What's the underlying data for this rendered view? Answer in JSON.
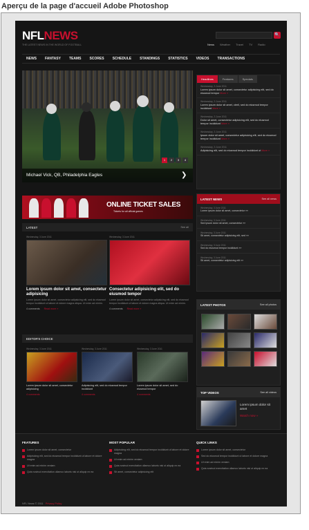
{
  "caption": "Aperçu de la page d'accueil Adobe Photoshop",
  "header": {
    "logo_a": "NFL",
    "logo_b": "NEWS",
    "tagline": "THE LATEST NEWS IN THE WORLD OF FOOTBALL",
    "search_button": "🔍",
    "top_links": [
      "News",
      "Weather",
      "Travel",
      "TV",
      "Radio"
    ]
  },
  "nav": [
    "NEWS",
    "FANTASY",
    "TEAMS",
    "SCORES",
    "SCHEDULE",
    "STANDINGS",
    "STATISTICS",
    "VIDEOS",
    "TRANSACTIONS"
  ],
  "hero": {
    "caption": "Michael Vick, QB, Philadelphia Eagles",
    "pages": [
      "1",
      "2",
      "3",
      "4"
    ],
    "arrow": "❯"
  },
  "headlines": {
    "tabs": [
      "Headlines",
      "Features",
      "Specials"
    ],
    "items": [
      {
        "date": "Wednesday, 3 June 2011",
        "text": "Lorem ipsum dolor sit amet, consectetur adipisicing elit, sed do eiusmod tempor",
        "more": "More »"
      },
      {
        "date": "Wednesday, 3 June 2011",
        "text": "Lorem ipsum dolor sit amet, cteril, sed do eiusmod tempor incididunt",
        "more": "More »"
      },
      {
        "date": "Wednesday, 3 June 2011",
        "text": "Dolor sit amet, consectetur adipisicing elit, sed do eiusmod tempor incididunt",
        "more": "More »"
      },
      {
        "date": "Wednesday, 3 June 2011",
        "text": "Ipsum dolor sit amet, consectetur adipisicing elit, sed do eiusmod tempor incididunt",
        "more": "More »"
      },
      {
        "date": "Wednesday, 3 June 2011",
        "text": "Adipisicing elit, sed do eiusmod tempor incididunt ut",
        "more": "More »"
      }
    ]
  },
  "banner": {
    "text": "ONLINE TICKET SALES",
    "sub": "Tickets for all official games"
  },
  "latest_news": {
    "title": "LATEST NEWS",
    "all": "See all news",
    "items": [
      {
        "date": "Wednesday, 3 June 2011",
        "text": "Lorem ipsum dolor sit amet, consectetur »»"
      },
      {
        "date": "Wednesday, 3 June 2011",
        "text": "Sed ipsum dolor sit amet, consectetur »»"
      },
      {
        "date": "Wednesday, 3 June 2011",
        "text": "Sit amet, consectetur adipisicing elit, sed »»"
      },
      {
        "date": "Wednesday, 3 June 2011",
        "text": "Sed do eiusmod tempor incididunt »»"
      },
      {
        "date": "Wednesday, 3 June 2011",
        "text": "Sit amet, consectetur adipisicing elit »»"
      }
    ]
  },
  "latest": {
    "title": "LATEST",
    "all": "See all",
    "cards": [
      {
        "date": "Wednesday, 3 June 2011",
        "title": "Lorem ipsum dolor sit amet, consectetur adipisicing",
        "body": "Lorem ipsum dolor sit amet, consectetur adipisicing elit, sed do eiusmod tempor incididunt ut labore et dolore magna aliqua. Ut enim ad minim.",
        "comments": "4 comments",
        "more": "Read more »"
      },
      {
        "date": "Wednesday, 3 June 2011",
        "title": "Consectetur adipisicing elit, sed do eiusmod tempor",
        "body": "Lorem ipsum dolor sit amet, consectetur adipisicing elit, sed do eiusmod tempor incididunt ut labore et dolore magna aliqua. Ut enim ad minim.",
        "comments": "4 comments",
        "more": "Read more »"
      }
    ]
  },
  "editors_choice": {
    "title": "EDITOR'S CHOICE",
    "cards": [
      {
        "date": "Wednesday, 3 June 2011",
        "title": "Lorem ipsum dolor sit amet, consectetur adipisicing",
        "comments": "4 comments"
      },
      {
        "date": "Wednesday, 3 June 2011",
        "title": "Adipisicing elit, sed do eiusmod tempor incididunt",
        "comments": "4 comments"
      },
      {
        "date": "Wednesday, 3 June 2011",
        "title": "Lorem ipsum dolor sit amet, sed do eiusmod tempor",
        "comments": "4 comments"
      }
    ]
  },
  "photos": {
    "title": "LATEST PHOTOS",
    "all": "See all photos"
  },
  "videos": {
    "title": "TOP VIDEOS",
    "all": "See all videos",
    "text": "Lorem ipsum dolor sit amet",
    "more": "Watch now »"
  },
  "footer": {
    "features": {
      "title": "FEATURES",
      "items": [
        "Lorem ipsum dolor sit amet, consectetur",
        "Adipisicing elit, sed do eiusmod tempor incididunt ut labore et dolore magna",
        "Ut enim ad minim veniam",
        "Quis nostrud exercitation ullamco laboris nisi ut aliquip ex ea"
      ]
    },
    "popular": {
      "title": "MOST POPULAR",
      "items": [
        "Adipisicing elit, sed do eiusmod tempor incididunt ut labore et dolore magna",
        "Ut enim ad minim veniam",
        "Quis nostrud exercitation ullamco laboris nisi ut aliquip ex ea",
        "Sit amet, consectetur adipisicing elit"
      ]
    },
    "quick": {
      "title": "QUICK LINKS",
      "items": [
        "Lorem ipsum dolor sit amet, consectetur",
        "Sed do eiusmod tempor incididunt ut labore et dolore magna",
        "Ut enim ad minim veniam",
        "Quis nostrud exercitation ullamco laboris nisi ut aliquip ex ea"
      ]
    },
    "copyright": "NFL News © 2011",
    "privacy": "Privacy Policy"
  }
}
